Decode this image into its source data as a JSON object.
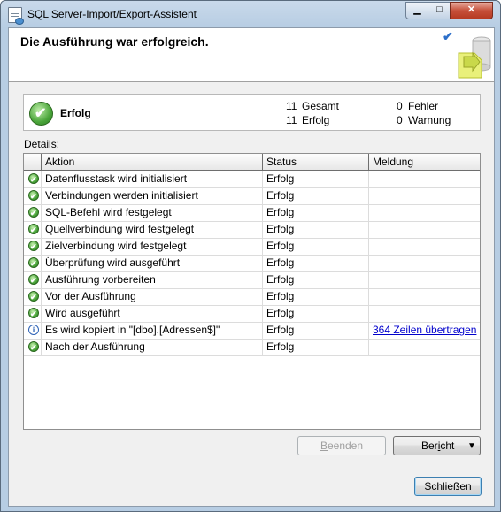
{
  "window": {
    "title": "SQL Server-Import/Export-Assistent",
    "min_glyph": "▁",
    "max_glyph": "□",
    "close_glyph": "✕"
  },
  "header": {
    "title": "Die Ausführung war erfolgreich."
  },
  "summary": {
    "status": "Erfolg",
    "total": "11",
    "total_label": "Gesamt",
    "success": "11",
    "success_label": "Erfolg",
    "errors": "0",
    "errors_label": "Fehler",
    "warnings": "0",
    "warnings_label": "Warnung"
  },
  "details": {
    "label_pre": "Det",
    "label_mn": "a",
    "label_post": "ils:",
    "columns": [
      "Aktion",
      "Status",
      "Meldung"
    ],
    "rows": [
      {
        "icon": "success-icon",
        "action": "Datenflusstask wird initialisiert",
        "status": "Erfolg",
        "message": ""
      },
      {
        "icon": "success-icon",
        "action": "Verbindungen werden initialisiert",
        "status": "Erfolg",
        "message": ""
      },
      {
        "icon": "success-icon",
        "action": "SQL-Befehl wird festgelegt",
        "status": "Erfolg",
        "message": ""
      },
      {
        "icon": "success-icon",
        "action": "Quellverbindung wird festgelegt",
        "status": "Erfolg",
        "message": ""
      },
      {
        "icon": "success-icon",
        "action": "Zielverbindung wird festgelegt",
        "status": "Erfolg",
        "message": ""
      },
      {
        "icon": "success-icon",
        "action": "Überprüfung wird ausgeführt",
        "status": "Erfolg",
        "message": ""
      },
      {
        "icon": "success-icon",
        "action": "Ausführung vorbereiten",
        "status": "Erfolg",
        "message": ""
      },
      {
        "icon": "success-icon",
        "action": "Vor der Ausführung",
        "status": "Erfolg",
        "message": ""
      },
      {
        "icon": "success-icon",
        "action": "Wird ausgeführt",
        "status": "Erfolg",
        "message": ""
      },
      {
        "icon": "info-icon",
        "action": "Es wird kopiert in \"[dbo].[Adressen$]\"",
        "status": "Erfolg",
        "message": "364 Zeilen übertragen"
      },
      {
        "icon": "success-icon",
        "action": "Nach der Ausführung",
        "status": "Erfolg",
        "message": ""
      }
    ]
  },
  "buttons": {
    "finish_pre": "",
    "finish_mn": "B",
    "finish_post": "eenden",
    "report_pre": "Ber",
    "report_mn": "i",
    "report_post": "cht",
    "report_arrow": "▼",
    "close": "Schließen"
  }
}
